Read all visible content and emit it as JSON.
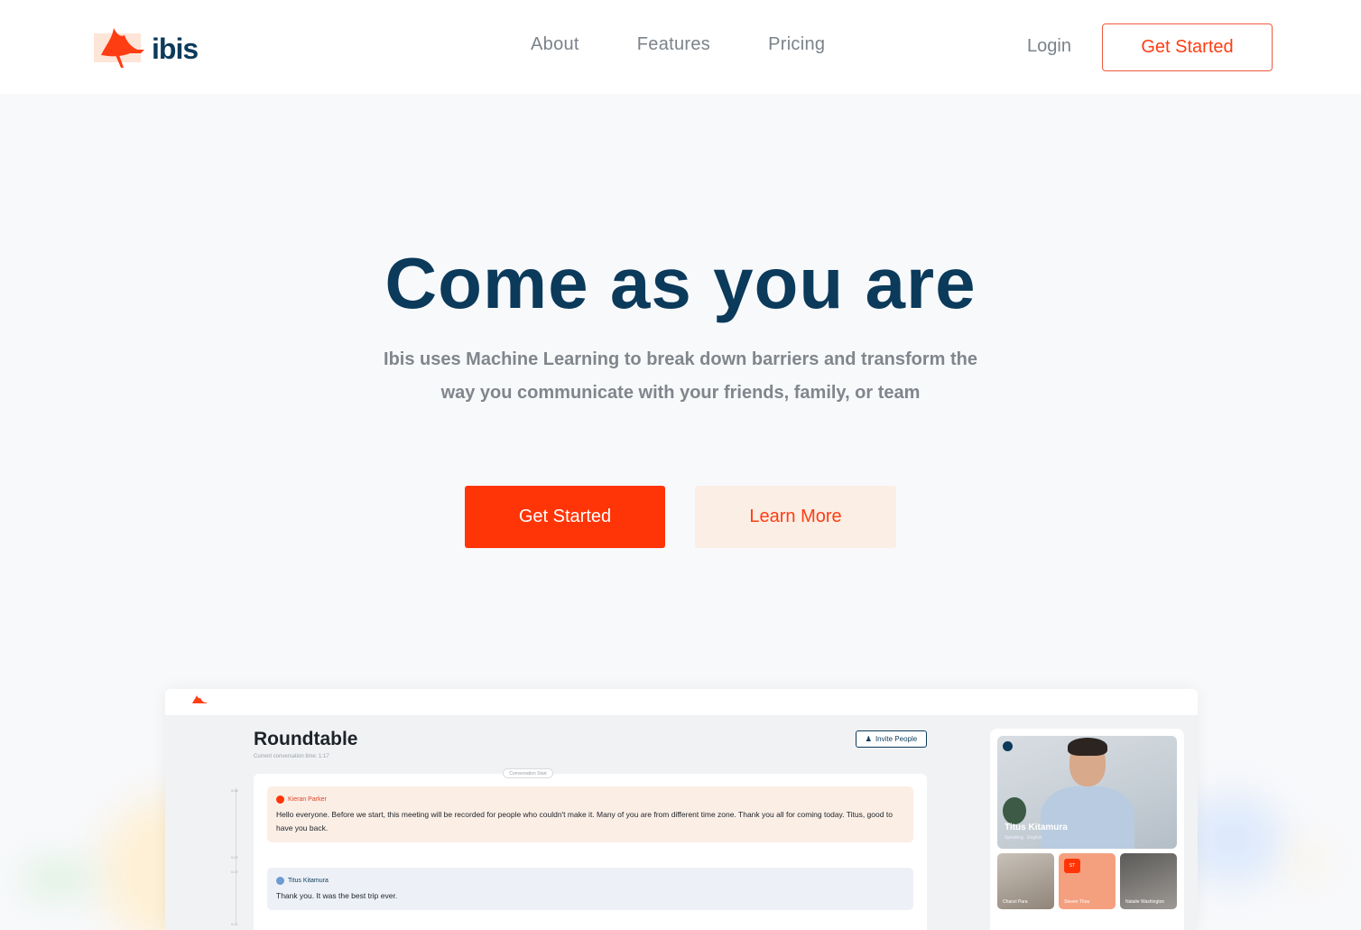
{
  "header": {
    "logo_text": "ibis",
    "nav": [
      "About",
      "Features",
      "Pricing"
    ],
    "login": "Login",
    "cta": "Get Started"
  },
  "hero": {
    "title": "Come as you are",
    "subtitle": "Ibis uses Machine Learning to break down barriers and transform the way you communicate with your friends, family, or team",
    "primary_button": "Get Started",
    "secondary_button": "Learn More"
  },
  "preview": {
    "title": "Roundtable",
    "conversation_time": "Current conversation time: 1:17",
    "invite_button": "Invite People",
    "conversation_start": "Conversation Start",
    "ticks": [
      "0:45",
      "0:02",
      "0:07",
      "0:21"
    ],
    "messages": [
      {
        "author": "Kieran Parker",
        "text": "Hello everyone. Before we start, this meeting will be recorded for people who couldn't make it. Many of you are from different time zone. Thank you all for coming today. Titus, good to have you back."
      },
      {
        "author": "Titus Kitamura",
        "text": "Thank you. It was the best trip ever."
      }
    ],
    "main_video": {
      "name": "Titus Kitamura",
      "subtitle": "Speaking · English"
    },
    "thumbnails": [
      {
        "label": "Chanzi Para"
      },
      {
        "label": "Steven Thou",
        "badge": "ST"
      },
      {
        "label": "Natalie Washington"
      }
    ]
  },
  "colors": {
    "brand_navy": "#0b3a5b",
    "brand_orange": "#ff3508",
    "secondary_bg": "#fbeee5"
  }
}
